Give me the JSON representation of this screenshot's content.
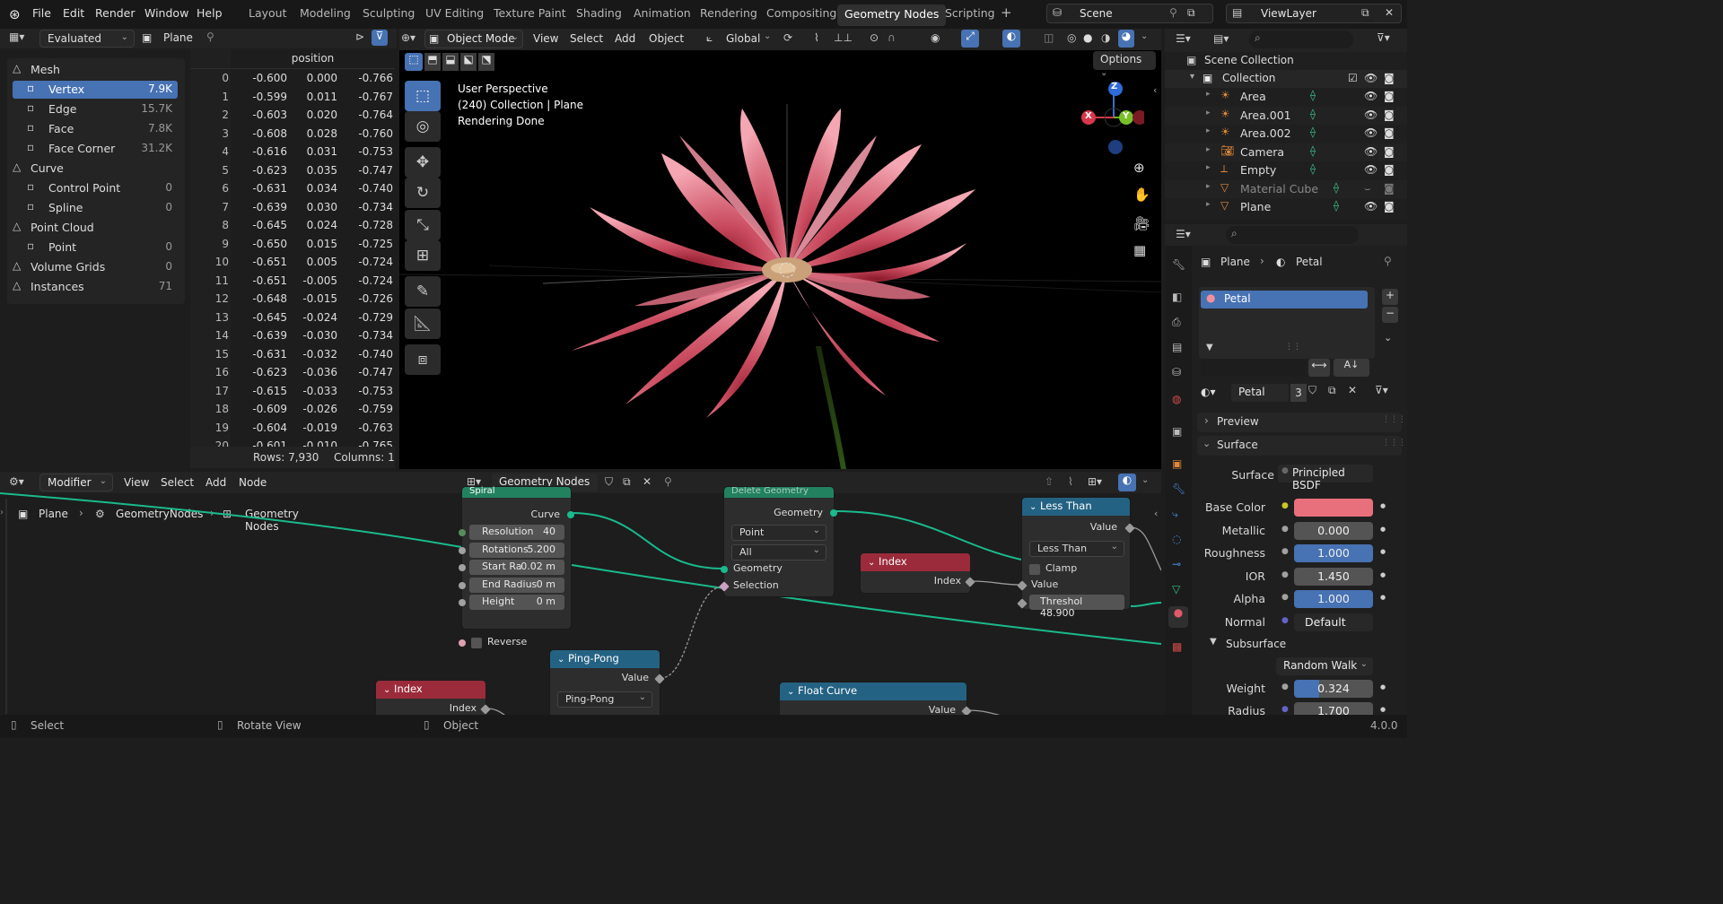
{
  "topbar": {
    "menu": [
      "File",
      "Edit",
      "Render",
      "Window",
      "Help"
    ],
    "workspaces": [
      "Layout",
      "Modeling",
      "Sculpting",
      "UV Editing",
      "Texture Paint",
      "Shading",
      "Animation",
      "Rendering",
      "Compositing",
      "Geometry Nodes",
      "Scripting"
    ],
    "active_workspace": "Geometry Nodes",
    "add_tab": "+",
    "scene": "Scene",
    "view_layer": "ViewLayer"
  },
  "spreadsheet": {
    "header": {
      "mode": "Evaluated",
      "object": "Plane"
    },
    "tree": [
      {
        "label": "Mesh",
        "count": "",
        "level": 0,
        "icon": "mesh-icon"
      },
      {
        "label": "Vertex",
        "count": "7.9K",
        "level": 1,
        "icon": "vertex-icon",
        "selected": true
      },
      {
        "label": "Edge",
        "count": "15.7K",
        "level": 1,
        "icon": "edge-icon"
      },
      {
        "label": "Face",
        "count": "7.8K",
        "level": 1,
        "icon": "face-icon"
      },
      {
        "label": "Face Corner",
        "count": "31.2K",
        "level": 1,
        "icon": "face-corner-icon"
      },
      {
        "label": "Curve",
        "count": "",
        "level": 0,
        "icon": "curve-icon"
      },
      {
        "label": "Control Point",
        "count": "0",
        "level": 1,
        "icon": "control-point-icon"
      },
      {
        "label": "Spline",
        "count": "0",
        "level": 1,
        "icon": "spline-icon"
      },
      {
        "label": "Point Cloud",
        "count": "",
        "level": 0,
        "icon": "point-cloud-icon"
      },
      {
        "label": "Point",
        "count": "0",
        "level": 1,
        "icon": "point-icon"
      },
      {
        "label": "Volume Grids",
        "count": "0",
        "level": 0,
        "icon": "volume-icon"
      },
      {
        "label": "Instances",
        "count": "71",
        "level": 0,
        "icon": "instances-icon"
      }
    ],
    "column_header": "position",
    "rows": [
      [
        "0",
        "-0.600",
        "0.000",
        "-0.766"
      ],
      [
        "1",
        "-0.599",
        "0.011",
        "-0.767"
      ],
      [
        "2",
        "-0.603",
        "0.020",
        "-0.764"
      ],
      [
        "3",
        "-0.608",
        "0.028",
        "-0.760"
      ],
      [
        "4",
        "-0.616",
        "0.031",
        "-0.753"
      ],
      [
        "5",
        "-0.623",
        "0.035",
        "-0.747"
      ],
      [
        "6",
        "-0.631",
        "0.034",
        "-0.740"
      ],
      [
        "7",
        "-0.639",
        "0.030",
        "-0.734"
      ],
      [
        "8",
        "-0.645",
        "0.024",
        "-0.728"
      ],
      [
        "9",
        "-0.650",
        "0.015",
        "-0.725"
      ],
      [
        "10",
        "-0.651",
        "0.005",
        "-0.724"
      ],
      [
        "11",
        "-0.651",
        "-0.005",
        "-0.724"
      ],
      [
        "12",
        "-0.648",
        "-0.015",
        "-0.726"
      ],
      [
        "13",
        "-0.645",
        "-0.024",
        "-0.729"
      ],
      [
        "14",
        "-0.639",
        "-0.030",
        "-0.734"
      ],
      [
        "15",
        "-0.631",
        "-0.032",
        "-0.740"
      ],
      [
        "16",
        "-0.623",
        "-0.036",
        "-0.747"
      ],
      [
        "17",
        "-0.615",
        "-0.033",
        "-0.753"
      ],
      [
        "18",
        "-0.609",
        "-0.026",
        "-0.759"
      ],
      [
        "19",
        "-0.604",
        "-0.019",
        "-0.763"
      ],
      [
        "20",
        "-0.601",
        "-0.010",
        "-0.765"
      ]
    ],
    "rows_label": "Rows: 7,930",
    "cols_label": "Columns: 1"
  },
  "viewport": {
    "mode": "Object Mode",
    "menus": [
      "View",
      "Select",
      "Add",
      "Object"
    ],
    "orientation": "Global",
    "options": "Options",
    "overlay_lines": [
      "User Perspective",
      "(240) Collection | Plane",
      "Rendering Done"
    ],
    "gizmo": {
      "x": "X",
      "y": "Y",
      "z": "Z"
    }
  },
  "outliner": {
    "root": "Scene Collection",
    "collection": "Collection",
    "items": [
      {
        "label": "Area",
        "dim": false
      },
      {
        "label": "Area.001",
        "dim": false
      },
      {
        "label": "Area.002",
        "dim": false
      },
      {
        "label": "Camera",
        "dim": false
      },
      {
        "label": "Empty",
        "dim": false
      },
      {
        "label": "Material Cube",
        "dim": true
      },
      {
        "label": "Plane",
        "dim": false
      }
    ]
  },
  "properties": {
    "breadcrumb": {
      "object": "Plane",
      "material": "Petal"
    },
    "slot": "Petal",
    "material_name": "Petal",
    "users": "3",
    "sections": {
      "preview": "Preview",
      "surface": "Surface",
      "subsurface": "Subsurface"
    },
    "surface_label": "Surface",
    "surface_value": "Principled BSDF",
    "fields": [
      {
        "label": "Base Color",
        "value": "",
        "type": "color"
      },
      {
        "label": "Metallic",
        "value": "0.000",
        "type": "gray"
      },
      {
        "label": "Roughness",
        "value": "1.000",
        "type": "blue"
      },
      {
        "label": "IOR",
        "value": "1.450",
        "type": "gray"
      },
      {
        "label": "Alpha",
        "value": "1.000",
        "type": "blue"
      },
      {
        "label": "Normal",
        "value": "Default",
        "type": "dark"
      }
    ],
    "subsurface_method": "Random Walk",
    "sub_fields": [
      {
        "label": "Weight",
        "value": "0.324",
        "fill": 0.324
      },
      {
        "label": "Radius",
        "value": "1.700",
        "fill": 0
      }
    ],
    "base_color": "#e8707c"
  },
  "node_editor": {
    "header": {
      "type": "Modifier",
      "menus": [
        "View",
        "Select",
        "Add",
        "Node"
      ],
      "tree_name": "Geometry Nodes"
    },
    "breadcrumb": [
      "Plane",
      "GeometryNodes",
      "Geometry Nodes"
    ],
    "spiral": {
      "title": "Spiral",
      "output": "Curve",
      "fields": [
        {
          "label": "Resolution",
          "value": "40"
        },
        {
          "label": "Rotations",
          "value": "5.200"
        },
        {
          "label": "Start Ra",
          "value": "0.02 m"
        },
        {
          "label": "End Radius",
          "value": "0 m"
        },
        {
          "label": "Height",
          "value": "0 m"
        }
      ],
      "reverse": "Reverse"
    },
    "delete_geometry": {
      "title": "Delete Geometry",
      "output": "Geometry",
      "domain": "Point",
      "mode": "All",
      "inputs": [
        "Geometry",
        "Selection"
      ]
    },
    "index_a": {
      "title": "Index",
      "output": "Index"
    },
    "index_b": {
      "title": "Index",
      "output": "Index"
    },
    "less_than": {
      "title": "Less Than",
      "output": "Value",
      "operation": "Less Than",
      "clamp": "Clamp",
      "input": "Value",
      "threshold_label": "Threshol",
      "threshold_value": "48.900"
    },
    "ping_pong": {
      "title": "Ping-Pong",
      "output": "Value",
      "operation": "Ping-Pong"
    },
    "float_curve": {
      "title": "Float Curve",
      "output": "Value"
    }
  },
  "statusbar": {
    "items": [
      "Select",
      "Rotate View",
      "Object"
    ],
    "version": "4.0.0"
  }
}
